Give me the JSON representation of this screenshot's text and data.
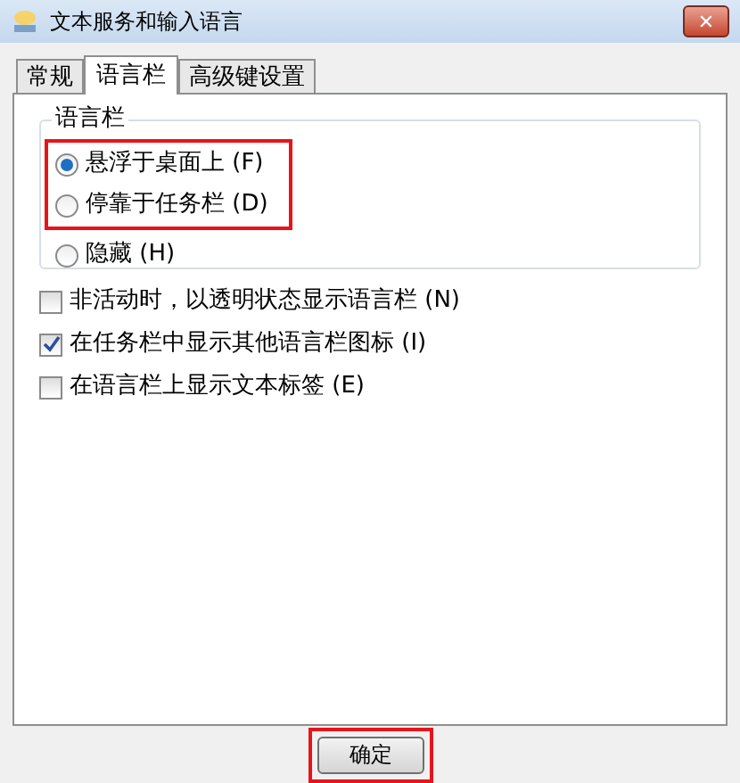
{
  "window": {
    "title": "文本服务和输入语言",
    "close": "✕"
  },
  "tabs": [
    {
      "label": "常规",
      "selected": false
    },
    {
      "label": "语言栏",
      "selected": true
    },
    {
      "label": "高级键设置",
      "selected": false
    }
  ],
  "group": {
    "title": "语言栏",
    "radios": [
      {
        "label": "悬浮于桌面上 (F)",
        "selected": true,
        "highlighted": true
      },
      {
        "label": "停靠于任务栏 (D)",
        "selected": false,
        "highlighted": true
      },
      {
        "label": "隐藏 (H)",
        "selected": false,
        "highlighted": false
      }
    ]
  },
  "checkboxes": [
    {
      "label": "非活动时，以透明状态显示语言栏 (N)",
      "checked": false
    },
    {
      "label": "在任务栏中显示其他语言栏图标 (I)",
      "checked": true
    },
    {
      "label": "在语言栏上显示文本标签 (E)",
      "checked": false
    }
  ],
  "buttons": [
    {
      "label": "确定",
      "highlighted": true
    }
  ]
}
